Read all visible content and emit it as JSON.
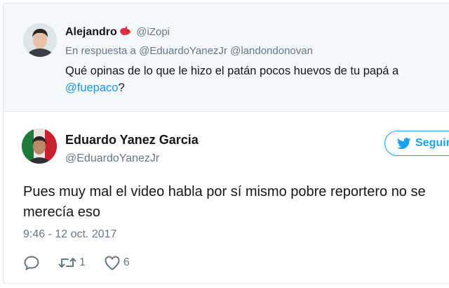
{
  "reply_tweet": {
    "name": "Alejandro",
    "handle": "@iZopi",
    "context_prefix": "En respuesta a",
    "context_mentions": [
      "@EduardoYanezJr",
      "@landondonovan"
    ],
    "text_line1": "Qué opinas de lo que le hizo el patán pocos huevos de tu papá a",
    "text_mention": "@fuepaco",
    "text_end": "?"
  },
  "main_tweet": {
    "name": "Eduardo Yanez Garcia",
    "handle": "@EduardoYanezJr",
    "follow_label": "Seguir",
    "text": "Pues muy mal el video habla por sí mismo pobre reportero no se merecía eso",
    "timestamp": "9:46 - 12 oct. 2017"
  },
  "actions": {
    "reply_icon": "reply-icon",
    "retweet_icon": "retweet-icon",
    "retweet_count": "1",
    "like_icon": "heart-icon",
    "like_count": "6"
  },
  "colors": {
    "link": "#1b95e0",
    "twitter_blue": "#1da1f2",
    "secondary_text": "#657786",
    "reply_background": "#f5f8fa",
    "bird_emoji": "#dd2e44"
  }
}
